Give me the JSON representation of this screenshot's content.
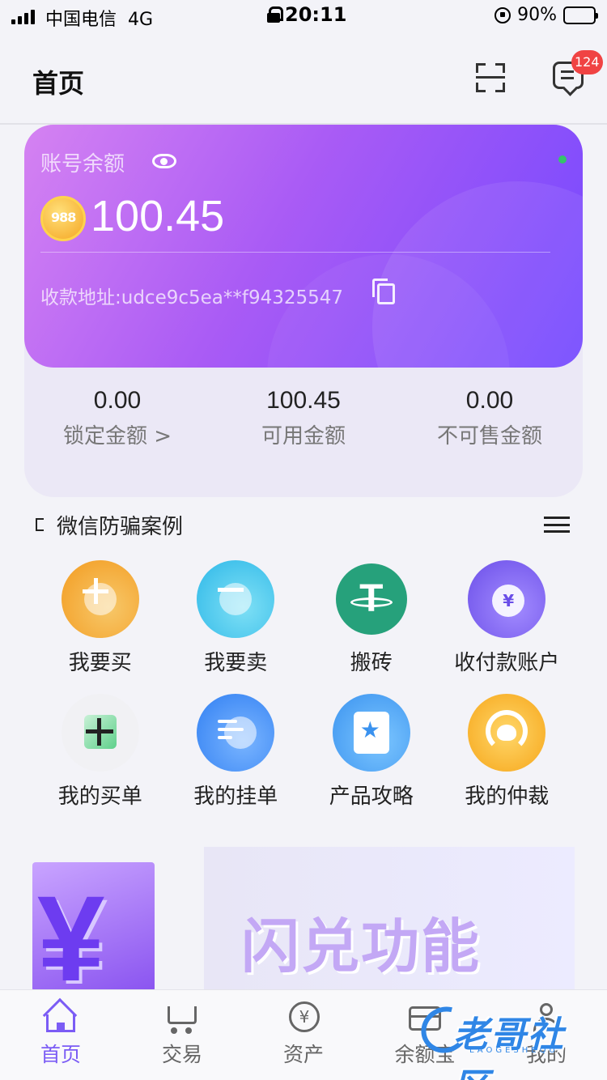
{
  "status_bar": {
    "carrier": "中国电信",
    "network": "4G",
    "time": "20:11",
    "battery": "90%"
  },
  "header": {
    "title": "首页",
    "unread_count": "124"
  },
  "balance": {
    "label": "账号余额",
    "amount": "100.45",
    "coin_text": "988",
    "address": "收款地址:udce9c5ea**f94325547",
    "stats": [
      {
        "value": "0.00",
        "label": "锁定金额 >"
      },
      {
        "value": "100.45",
        "label": "可用金额"
      },
      {
        "value": "0.00",
        "label": "不可售金额"
      }
    ]
  },
  "notice": {
    "text": "微信防骗案例"
  },
  "grid": [
    {
      "label": "我要买",
      "icon": "buy-plus-icon"
    },
    {
      "label": "我要卖",
      "icon": "sell-minus-icon"
    },
    {
      "label": "搬砖",
      "icon": "usdt-icon",
      "glyph": "T"
    },
    {
      "label": "收付款账户",
      "icon": "payment-account-icon",
      "glyph": "¥"
    },
    {
      "label": "我的买单",
      "icon": "my-buy-order-icon"
    },
    {
      "label": "我的挂单",
      "icon": "my-listing-icon"
    },
    {
      "label": "产品攻略",
      "icon": "guide-book-icon",
      "glyph": "★"
    },
    {
      "label": "我的仲裁",
      "icon": "arbitration-support-icon"
    }
  ],
  "banner": {
    "title": "闪兑功能",
    "left_glyph": "¥"
  },
  "tabbar": [
    {
      "label": "首页",
      "active": true
    },
    {
      "label": "交易"
    },
    {
      "label": "资产",
      "glyph": "¥"
    },
    {
      "label": "余额宝"
    },
    {
      "label": "我的"
    }
  ],
  "watermark": {
    "text": "老哥社区",
    "sub": "LAOGESHEQU"
  },
  "colors": {
    "accent": "#7b5cf5",
    "card_start": "#d582f2",
    "card_end": "#7348ff",
    "usdt": "#26a17b",
    "badge": "#f04343"
  }
}
